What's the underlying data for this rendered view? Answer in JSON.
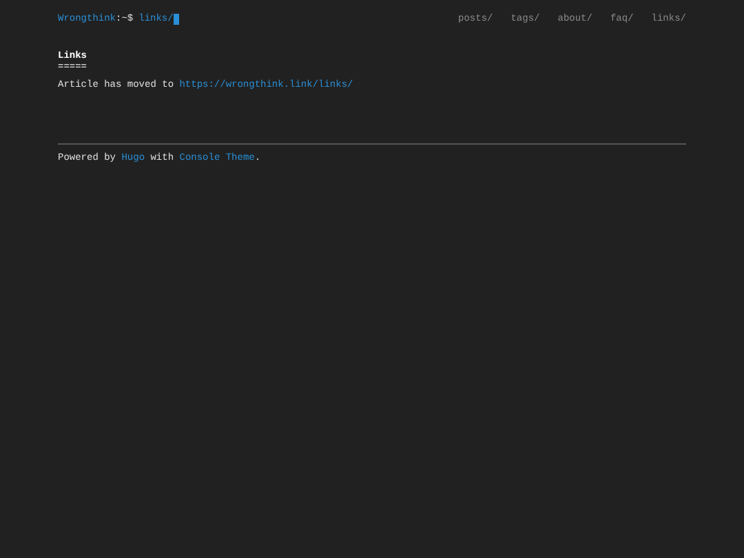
{
  "header": {
    "site": "Wrongthink",
    "prompt": ":~$",
    "path": "links/",
    "nav": [
      {
        "label": "posts/"
      },
      {
        "label": "tags/"
      },
      {
        "label": "about/"
      },
      {
        "label": "faq/"
      },
      {
        "label": "links/"
      }
    ]
  },
  "article": {
    "title": "Links",
    "underline": "=====",
    "text": "Article has moved to ",
    "link": "https://wrongthink.link/links/"
  },
  "footer": {
    "text_1": "Powered by ",
    "link_1": "Hugo",
    "text_2": " with ",
    "link_2": "Console Theme",
    "text_3": "."
  }
}
